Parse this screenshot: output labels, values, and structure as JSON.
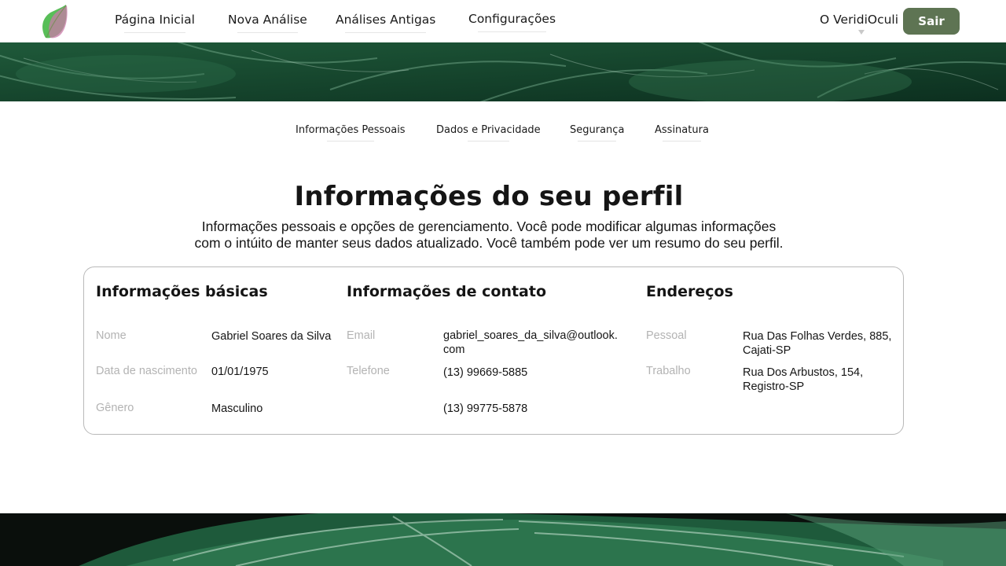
{
  "nav": {
    "home": "Página Inicial",
    "new_analysis": "Nova Análise",
    "old_analyses": "Análises Antigas",
    "settings": "Configurações",
    "about": "O VeridiOculi",
    "logout": "Sair"
  },
  "tabs": {
    "personal": "Informações Pessoais",
    "privacy": "Dados e Privacidade",
    "security": "Segurança",
    "subscription": "Assinatura"
  },
  "page": {
    "title": "Informações do seu perfil",
    "description_line1": "Informações pessoais e opções de gerenciamento. Você pode modificar algumas informações",
    "description_line2": "com o intúito de manter seus dados atualizado. Você também pode ver um resumo do seu perfil."
  },
  "basic": {
    "title": "Informações básicas",
    "name_label": "Nome",
    "name_value": "Gabriel Soares da Silva",
    "birth_label": "Data de nascimento",
    "birth_value": "01/01/1975",
    "gender_label": "Gênero",
    "gender_value": "Masculino"
  },
  "contact": {
    "title": "Informações de contato",
    "email_label": "Email",
    "email_value_line1": "gabriel_soares_da_silva@outlook.",
    "email_value_line2": "com",
    "phone_label": "Telefone",
    "phone_value1": "(13) 99669-5885",
    "phone_value2": "(13) 99775-5878"
  },
  "addresses": {
    "title": "Endereços",
    "personal_label": "Pessoal",
    "personal_value_line1": "Rua Das Folhas Verdes, 885,",
    "personal_value_line2": "Cajati-SP",
    "work_label": "Trabalho",
    "work_value_line1": "Rua Dos Arbustos, 154,",
    "work_value_line2": "Registro-SP"
  },
  "colors": {
    "logout_button": "#5e7453",
    "leaf_green": "#3bb33b",
    "leaf_pink": "#c97aa8"
  }
}
